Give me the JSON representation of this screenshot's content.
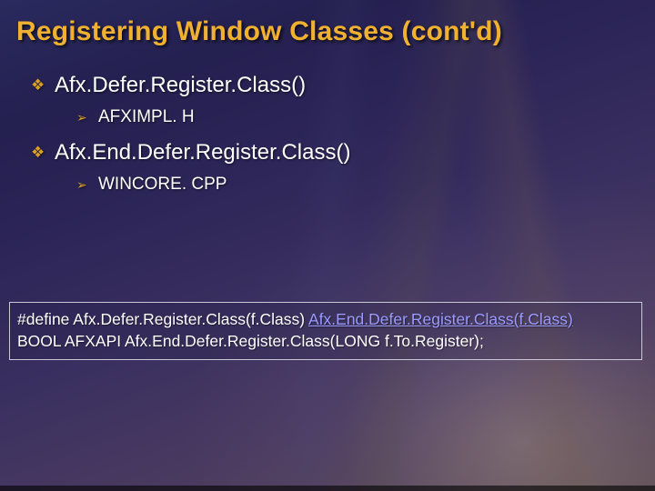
{
  "title": "Registering Window Classes (cont'd)",
  "bullets": [
    {
      "text": "Afx.Defer.Register.Class()",
      "sub": [
        {
          "text": "AFXIMPL. H"
        }
      ]
    },
    {
      "text": "Afx.End.Defer.Register.Class()",
      "sub": [
        {
          "text": "WINCORE. CPP"
        }
      ]
    }
  ],
  "code": {
    "line1_a": "#define Afx.Defer.Register.Class(f.Class)  ",
    "line1_b": "Afx.End.Defer.Register.Class(f.Class)",
    "line2": "BOOL AFXAPI Afx.End.Defer.Register.Class(LONG f.To.Register);"
  },
  "glyphs": {
    "diamond": "❖",
    "arrow": "➢"
  }
}
